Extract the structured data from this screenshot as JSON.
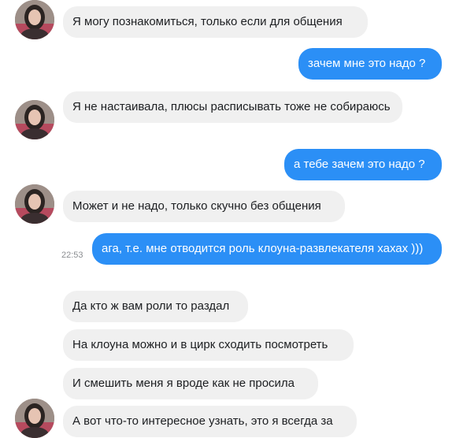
{
  "messages": [
    {
      "from": "contact",
      "text": "Я могу познакомиться, только если для общения"
    },
    {
      "from": "me",
      "text": "зачем мне это надо ?"
    },
    {
      "from": "contact",
      "text": "Я не настаивала, плюсы расписывать тоже не собираюсь"
    },
    {
      "from": "me",
      "text": "а тебе зачем это надо ?"
    },
    {
      "from": "contact",
      "text": "Может и не надо, только скучно без общения"
    },
    {
      "from": "me",
      "text": "ага, т.е. мне отводится роль клоуна-развлекателя хахах )))",
      "time": "22:53"
    },
    {
      "from": "contact",
      "text": "Да кто ж вам роли то раздал"
    },
    {
      "from": "contact",
      "text": "На клоуна можно и в цирк сходить посмотреть"
    },
    {
      "from": "contact",
      "text": "И смешить меня я вроде как не просила"
    },
    {
      "from": "contact",
      "text": "А вот что-то интересное узнать, это я всегда за"
    }
  ],
  "colors": {
    "incoming_bubble": "#f0f0f0",
    "outgoing_bubble": "#2b8ff6",
    "incoming_text": "#1c1e21",
    "outgoing_text": "#ffffff"
  }
}
